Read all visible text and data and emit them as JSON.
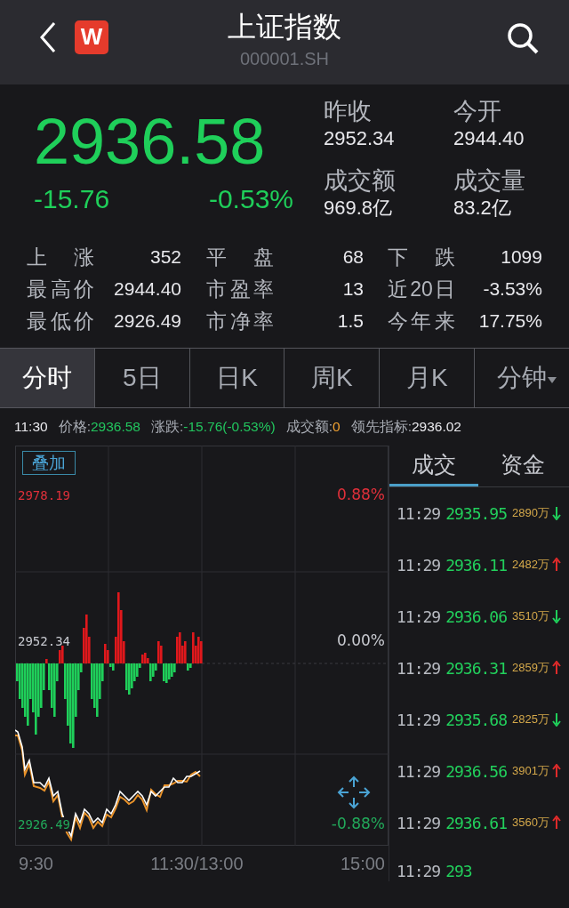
{
  "header": {
    "title": "上证指数",
    "code": "000001.SH",
    "logo": "W"
  },
  "quote": {
    "falling": true,
    "price": "2936.58",
    "change": "-15.76",
    "change_pct": "-0.53%",
    "fields": [
      {
        "label": "昨收",
        "value": "2952.34"
      },
      {
        "label": "今开",
        "value": "2944.40"
      },
      {
        "label": "成交额",
        "value": "969.8亿"
      },
      {
        "label": "成交量",
        "value": "83.2亿"
      }
    ]
  },
  "stats": [
    {
      "items": [
        {
          "label": "上涨",
          "value": "352"
        },
        {
          "label": "平盘",
          "value": "68"
        },
        {
          "label": "下跌",
          "value": "1099"
        }
      ]
    },
    {
      "items": [
        {
          "label": "最高价",
          "value": "2944.40"
        },
        {
          "label": "市盈率",
          "value": "13"
        },
        {
          "label": "近20日",
          "value": "-3.53%"
        }
      ]
    },
    {
      "items": [
        {
          "label": "最低价",
          "value": "2926.49"
        },
        {
          "label": "市净率",
          "value": "1.5"
        },
        {
          "label": "今年来",
          "value": "17.75%"
        }
      ]
    }
  ],
  "tabs": [
    {
      "label": "分时",
      "selected": true,
      "dropdown": false
    },
    {
      "label": "5日",
      "selected": false,
      "dropdown": false
    },
    {
      "label": "日K",
      "selected": false,
      "dropdown": false
    },
    {
      "label": "周K",
      "selected": false,
      "dropdown": false
    },
    {
      "label": "月K",
      "selected": false,
      "dropdown": false
    },
    {
      "label": "分钟",
      "selected": false,
      "dropdown": true
    }
  ],
  "info": {
    "time": "11:30",
    "items": [
      {
        "label": "价格:",
        "value": "2936.58",
        "color": "#22c55e"
      },
      {
        "label": "涨跌:",
        "value": "-15.76(-0.53%)",
        "color": "#22c55e"
      },
      {
        "label": "成交额:",
        "value": "0",
        "color": "#f0a030"
      },
      {
        "label": "领先指标:",
        "value": "2936.02",
        "color": "#e8e8ec"
      }
    ]
  },
  "chart": {
    "overlay_button": "叠加",
    "max_price": "2978.19",
    "max_pct": "0.88%",
    "base_price": "2952.34",
    "base_pct": "0.00%",
    "min_price": "2926.49",
    "min_pct": "-0.88%",
    "times": [
      "9:30",
      "11:30/13:00",
      "15:00"
    ]
  },
  "trades": {
    "tabs": [
      {
        "label": "成交",
        "selected": true
      },
      {
        "label": "资金",
        "selected": false
      }
    ],
    "rows": [
      {
        "time": "11:29",
        "price": "2935.95",
        "volume": "2890万",
        "up": false
      },
      {
        "time": "11:29",
        "price": "2936.11",
        "volume": "2482万",
        "up": true
      },
      {
        "time": "11:29",
        "price": "2936.06",
        "volume": "3510万",
        "up": false
      },
      {
        "time": "11:29",
        "price": "2936.31",
        "volume": "2859万",
        "up": true
      },
      {
        "time": "11:29",
        "price": "2935.68",
        "volume": "2825万",
        "up": false
      },
      {
        "time": "11:29",
        "price": "2936.56",
        "volume": "3901万",
        "up": true
      },
      {
        "time": "11:29",
        "price": "2936.61",
        "volume": "3560万",
        "up": true
      },
      {
        "time": "11:29",
        "price": "293"
      }
    ]
  }
}
